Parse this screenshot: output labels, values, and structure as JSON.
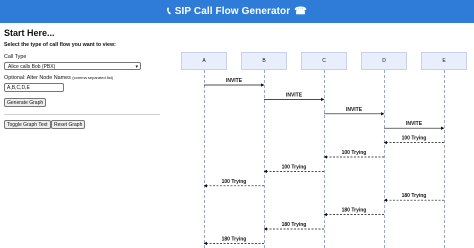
{
  "header": {
    "title": "SIP Call Flow Generator",
    "left_icon": "phone-icon",
    "right_icon": "phone-icon"
  },
  "form": {
    "heading": "Start Here...",
    "subtitle": "Select the type of call flow you want to view:",
    "call_type_label": "Call Type",
    "call_type_value": "Alice calls Bob (PBX)",
    "alter_label": "Optional: Alter Node Names",
    "alter_hint": "(comma separated list)",
    "node_names_value": "A,B,C,D,E",
    "generate_label": "Generate Graph",
    "toggle_label": "Toggle Graph Text",
    "reset_label": "Reset Graph"
  },
  "diagram": {
    "nodes": [
      "A",
      "B",
      "C",
      "D",
      "E"
    ],
    "messages": [
      {
        "from": 0,
        "to": 1,
        "label": "INVITE",
        "style": "solid"
      },
      {
        "from": 1,
        "to": 2,
        "label": "INVITE",
        "style": "solid"
      },
      {
        "from": 2,
        "to": 3,
        "label": "INVITE",
        "style": "solid"
      },
      {
        "from": 3,
        "to": 4,
        "label": "INVITE",
        "style": "solid"
      },
      {
        "from": 4,
        "to": 3,
        "label": "100 Trying",
        "style": "dashed"
      },
      {
        "from": 3,
        "to": 2,
        "label": "100 Trying",
        "style": "dashed"
      },
      {
        "from": 2,
        "to": 1,
        "label": "100 Trying",
        "style": "dashed"
      },
      {
        "from": 1,
        "to": 0,
        "label": "100 Trying",
        "style": "dashed"
      },
      {
        "from": 4,
        "to": 3,
        "label": "180 Trying",
        "style": "dashed"
      },
      {
        "from": 3,
        "to": 2,
        "label": "180 Trying",
        "style": "dashed"
      },
      {
        "from": 2,
        "to": 1,
        "label": "180 Trying",
        "style": "dashed"
      },
      {
        "from": 1,
        "to": 0,
        "label": "180 Trying",
        "style": "dashed"
      }
    ]
  }
}
